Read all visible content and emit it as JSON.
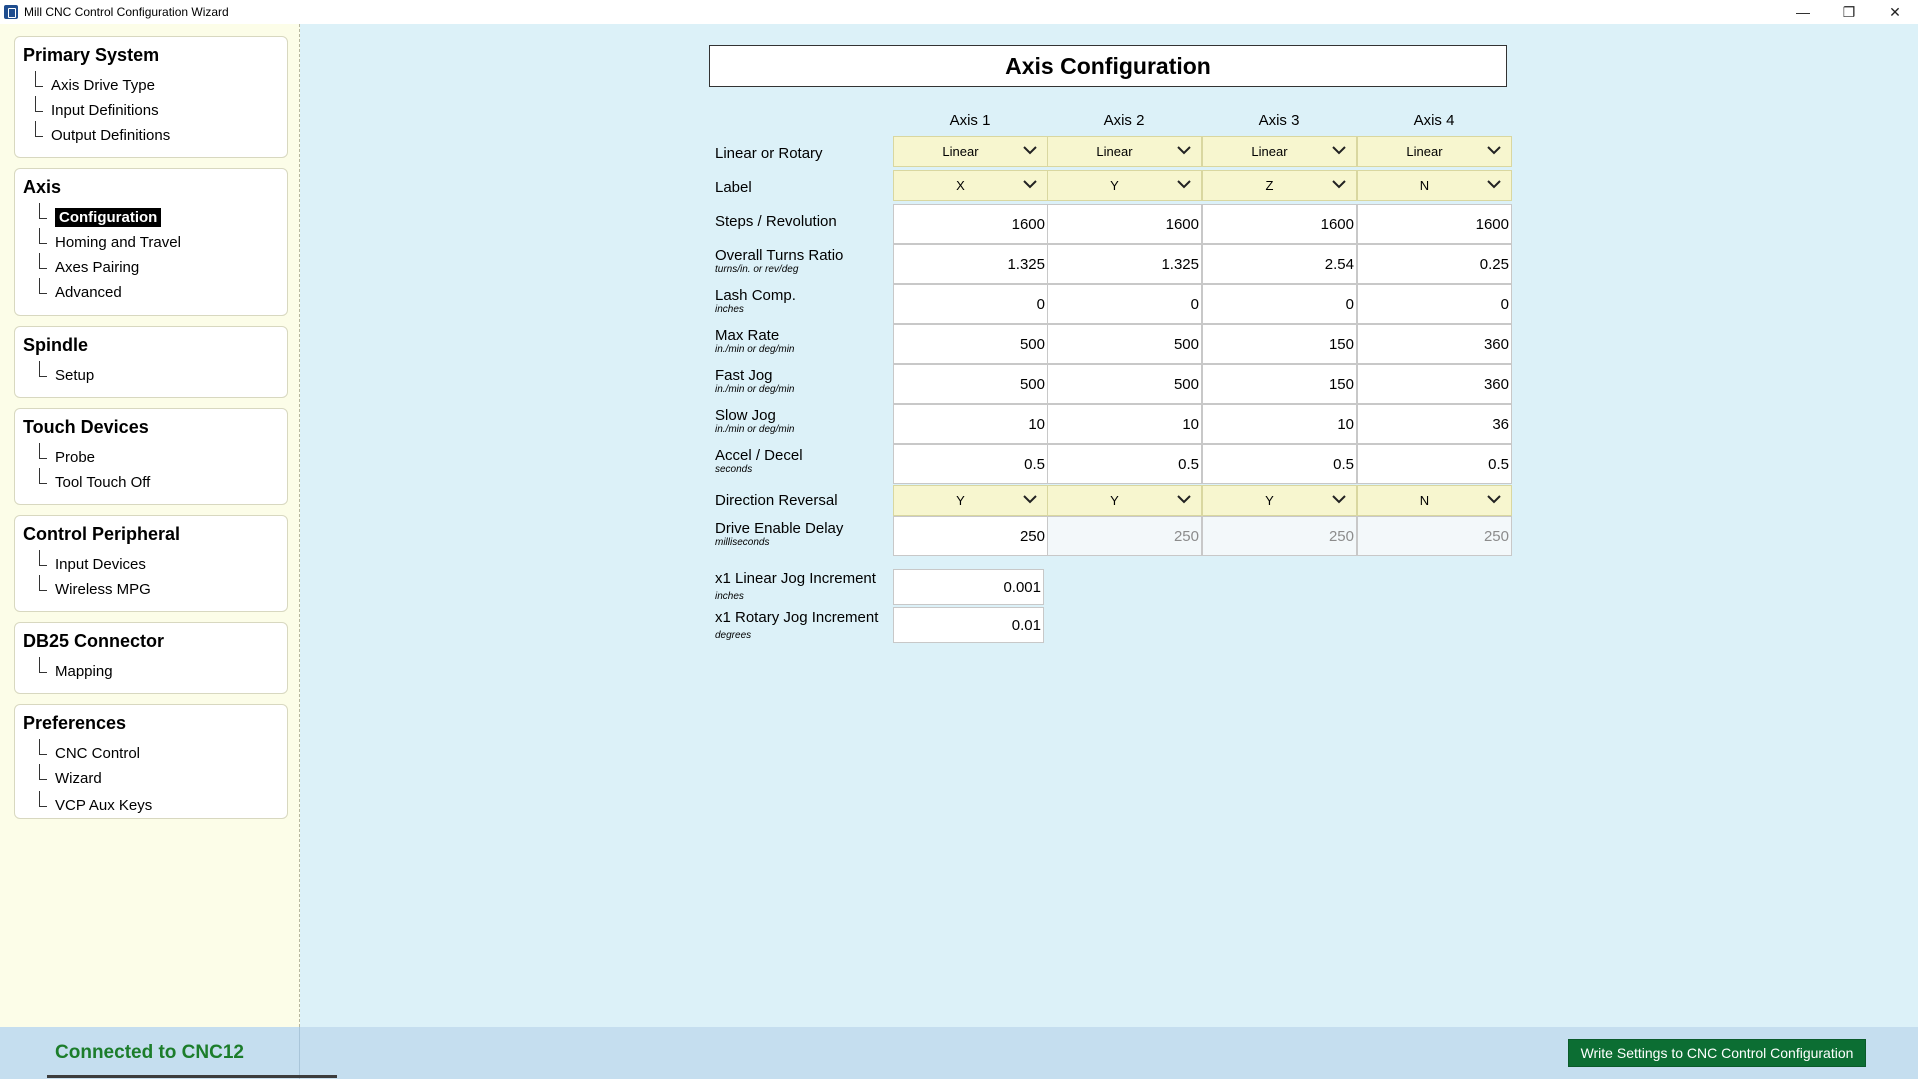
{
  "window": {
    "title": "Mill CNC Control Configuration Wizard",
    "controls": [
      "—",
      "❐",
      "✕"
    ]
  },
  "sidebar": {
    "groups": [
      {
        "title": "Primary System",
        "items": [
          "Axis Drive Type",
          "Input Definitions",
          "Output Definitions"
        ]
      },
      {
        "title": "Axis",
        "items": [
          "Configuration",
          "Homing and Travel",
          "Axes Pairing",
          "Advanced"
        ]
      },
      {
        "title": "Spindle",
        "items": [
          "Setup"
        ]
      },
      {
        "title": "Touch Devices",
        "items": [
          "Probe",
          "Tool Touch Off"
        ]
      },
      {
        "title": "Control Peripheral",
        "items": [
          "Input Devices",
          "Wireless MPG"
        ]
      },
      {
        "title": "DB25 Connector",
        "items": [
          "Mapping"
        ]
      },
      {
        "title": "Preferences",
        "items": [
          "CNC Control",
          "Wizard",
          "VCP Aux Keys"
        ]
      }
    ],
    "active_item": "Configuration"
  },
  "main": {
    "title": "Axis Configuration",
    "columns": [
      "Axis 1",
      "Axis 2",
      "Axis 3",
      "Axis 4"
    ],
    "rows": {
      "linear_or_rotary": {
        "label": "Linear or Rotary",
        "values": [
          "Linear",
          "Linear",
          "Linear",
          "Linear"
        ]
      },
      "label": {
        "label": "Label",
        "values": [
          "X",
          "Y",
          "Z",
          "N"
        ]
      },
      "steps_rev": {
        "label": "Steps / Revolution",
        "values": [
          "1600",
          "1600",
          "1600",
          "1600"
        ]
      },
      "turns_ratio": {
        "label": "Overall Turns Ratio",
        "sub": "turns/in. or rev/deg",
        "values": [
          "1.325",
          "1.325",
          "2.54",
          "0.25"
        ]
      },
      "lash_comp": {
        "label": "Lash Comp.",
        "sub": "inches",
        "values": [
          "0",
          "0",
          "0",
          "0"
        ]
      },
      "max_rate": {
        "label": "Max Rate",
        "sub": "in./min or deg/min",
        "values": [
          "500",
          "500",
          "150",
          "360"
        ]
      },
      "fast_jog": {
        "label": "Fast Jog",
        "sub": "in./min or deg/min",
        "values": [
          "500",
          "500",
          "150",
          "360"
        ]
      },
      "slow_jog": {
        "label": "Slow Jog",
        "sub": "in./min or deg/min",
        "values": [
          "10",
          "10",
          "10",
          "36"
        ]
      },
      "accel_decel": {
        "label": "Accel / Decel",
        "sub": "seconds",
        "values": [
          "0.5",
          "0.5",
          "0.5",
          "0.5"
        ]
      },
      "direction_reversal": {
        "label": "Direction Reversal",
        "values": [
          "Y",
          "Y",
          "Y",
          "N"
        ]
      },
      "drive_enable_delay": {
        "label": "Drive Enable Delay",
        "sub": "milliseconds",
        "values": [
          "250",
          "250",
          "250",
          "250"
        ]
      }
    },
    "jog": {
      "linear": {
        "label": "x1 Linear Jog Increment",
        "sub": "inches",
        "value": "0.001"
      },
      "rotary": {
        "label": "x1 Rotary Jog Increment",
        "sub": "degrees",
        "value": "0.01"
      }
    }
  },
  "status": {
    "connection": "Connected to CNC12",
    "write_button": "Write Settings to CNC Control Configuration"
  },
  "colors": {
    "sidebar_bg": "#fcfde8",
    "main_bg": "#dcf1f8",
    "dropdown_bg": "#f7f6cf",
    "status_green": "#1c7d2b",
    "write_button_bg": "#0c6e33"
  }
}
